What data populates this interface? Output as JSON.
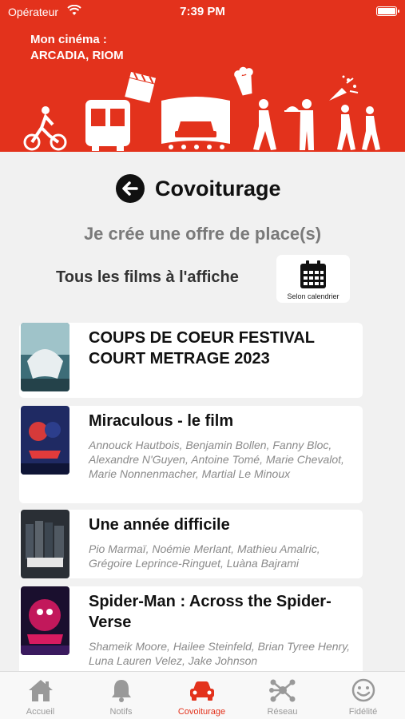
{
  "status_bar": {
    "carrier": "Opérateur",
    "time": "7:39 PM"
  },
  "header": {
    "cinema_label": "Mon cinéma :",
    "cinema_name": "ARCADIA, RIOM"
  },
  "page": {
    "title": "Covoiturage",
    "subtitle": "Je crée une offre de place(s)",
    "filter_label": "Tous les films à l'affiche",
    "calendar_button_label": "Selon calendrier"
  },
  "films": [
    {
      "title": "COUPS DE COEUR FESTIVAL COURT METRAGE 2023",
      "cast": ""
    },
    {
      "title": "Miraculous - le film",
      "cast": "Annouck Hautbois, Benjamin Bollen, Fanny Bloc, Alexandre N'Guyen, Antoine Tomé, Marie Chevalot, Marie Nonnenmacher, Martial Le Minoux"
    },
    {
      "title": "Une année difficile",
      "cast": "Pio Marmaï, Noémie Merlant, Mathieu Amalric, Grégoire Leprince-Ringuet, Luàna Bajrami"
    },
    {
      "title": "Spider-Man : Across the Spider-Verse",
      "cast": "Shameik Moore, Hailee Steinfeld, Brian Tyree Henry, Luna Lauren Velez, Jake Johnson"
    }
  ],
  "tabs": [
    {
      "label": "Accueil",
      "icon": "home-icon"
    },
    {
      "label": "Notifs",
      "icon": "bell-icon"
    },
    {
      "label": "Covoiturage",
      "icon": "car-icon",
      "active": true
    },
    {
      "label": "Réseau",
      "icon": "network-icon"
    },
    {
      "label": "Fidélité",
      "icon": "smiley-icon"
    }
  ],
  "colors": {
    "brand_red": "#e3321c",
    "inactive_gray": "#999999",
    "background": "#f1f1f1"
  }
}
